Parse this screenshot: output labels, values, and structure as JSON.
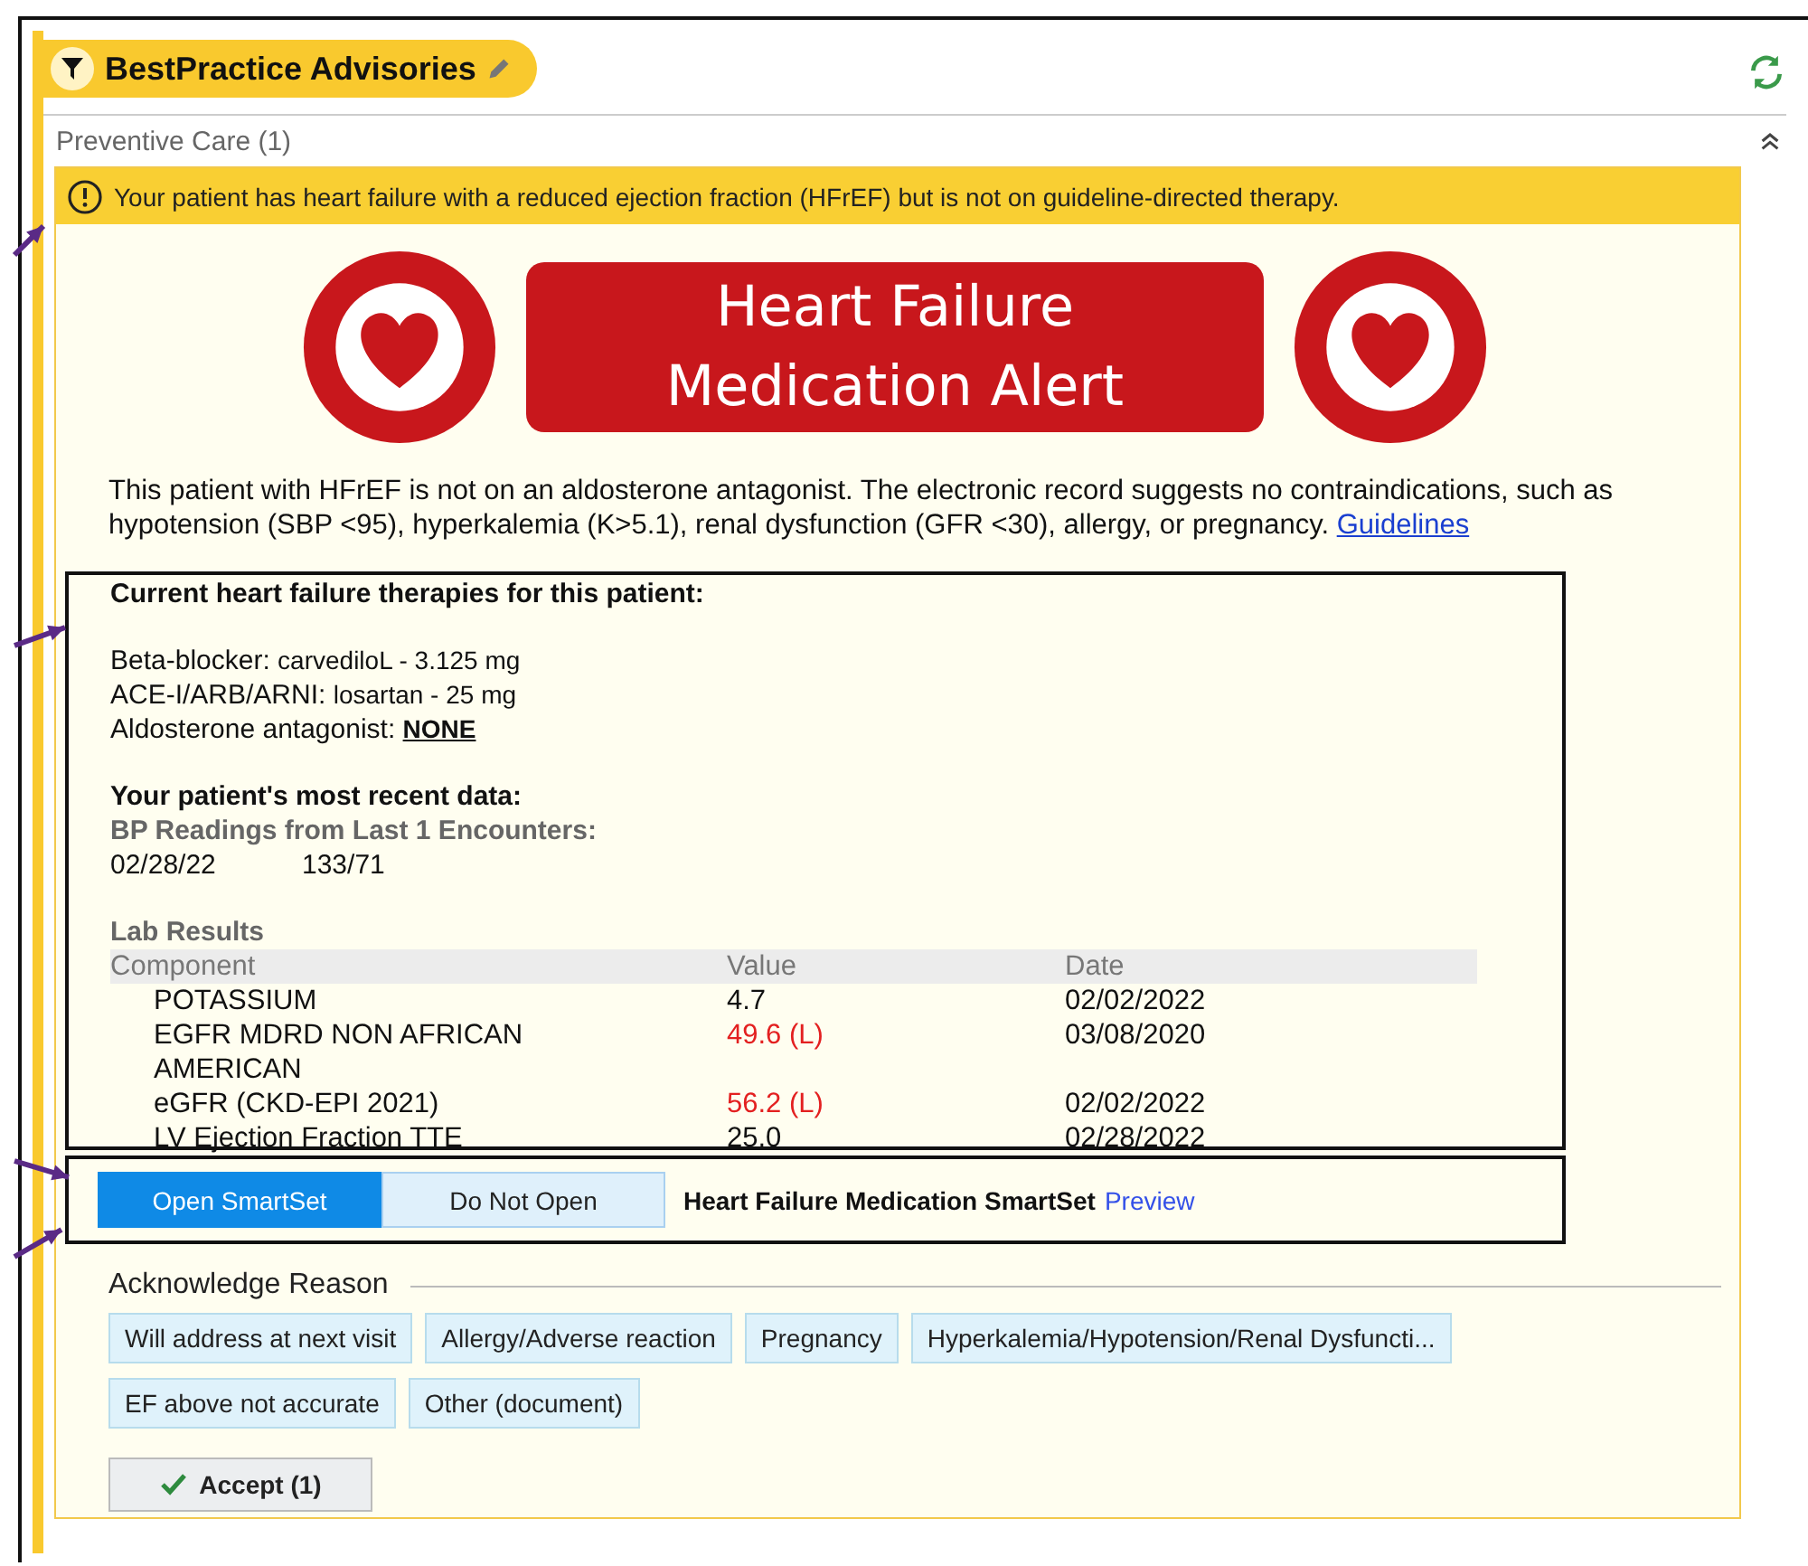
{
  "header": {
    "title": "BestPractice Advisories"
  },
  "section": {
    "title": "Preventive Care (1)",
    "expanded": true
  },
  "advisory": {
    "warning": "Your patient has heart failure with a reduced ejection fraction (HFrEF) but is not on guideline-directed therapy.",
    "banner": [
      "Heart Failure",
      "Medication Alert"
    ],
    "message": "This patient with HFrEF is not on an aldosterone antagonist. The electronic record suggests no contraindications, such as hypotension (SBP <95), hyperkalemia (K>5.1), renal dysfunction (GFR <30), allergy, or pregnancy.",
    "link": "Guidelines",
    "therapies": {
      "title": "Current heart failure therapies for this patient:",
      "items": [
        {
          "label": "Beta-blocker:",
          "value": "carvediloL - 3.125 mg",
          "kind": "plain"
        },
        {
          "label": "ACE-I/ARB/ARNI:",
          "value": "losartan - 25 mg",
          "kind": "plain"
        },
        {
          "label": "Aldosterone antagonist:",
          "value": "NONE",
          "kind": "flagged"
        }
      ]
    },
    "recent": {
      "title": "Your patient's most recent data:",
      "bp_title": "BP Readings from Last 1 Encounters:",
      "bp_readings": [
        {
          "date": "02/28/22",
          "value": "133/71"
        }
      ]
    },
    "labs": {
      "title": "Lab Results",
      "columns": [
        "Component",
        "Value",
        "Date"
      ],
      "rows": [
        {
          "component": "POTASSIUM",
          "value": "4.7",
          "date": "02/02/2022",
          "abnormal": false
        },
        {
          "component": "EGFR MDRD NON AFRICAN AMERICAN",
          "value": "49.6 (L)",
          "date": "03/08/2020",
          "abnormal": true
        },
        {
          "component": "eGFR (CKD-EPI 2021)",
          "value": "56.2 (L)",
          "date": "02/02/2022",
          "abnormal": true
        },
        {
          "component": "LV Ejection Fraction TTE",
          "value": "25.0",
          "date": "02/28/2022",
          "abnormal": false
        }
      ]
    },
    "actions": {
      "buttons": [
        {
          "label": "Open SmartSet",
          "selected": true
        },
        {
          "label": "Do Not Open",
          "selected": false
        }
      ],
      "smartset": "Heart Failure Medication SmartSet",
      "preview": "Preview"
    },
    "acknowledge": {
      "title": "Acknowledge Reason",
      "reasons": [
        "Will address at next visit",
        "Allergy/Adverse reaction",
        "Pregnancy",
        "Hyperkalemia/Hypotension/Renal Dysfuncti...",
        "EF above not accurate",
        "Other (document)"
      ],
      "accept": "Accept (1)"
    }
  }
}
